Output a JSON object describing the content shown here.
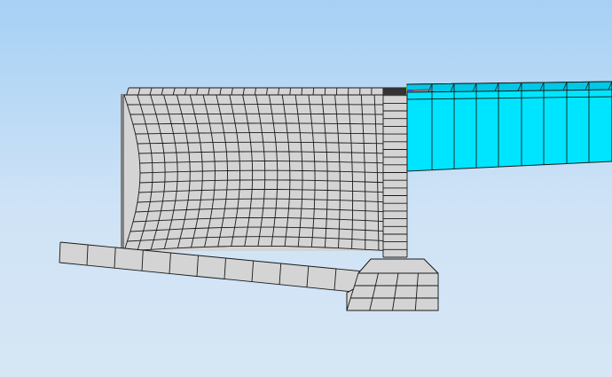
{
  "viewport": {
    "name": "fem-model-viewport",
    "background_top": "#a6d0f5",
    "background_bottom": "#d6e6f5"
  },
  "colors": {
    "mesh_fill": "#d4d4d4",
    "mesh_line": "#1a1a1a",
    "selected_fill": "#00e5ff",
    "selected_dark": "#00c8e6",
    "inner_wall_shadow": "#808080",
    "axis_x": "#e03030",
    "axis_y": "#30c030",
    "axis_z": "#3040e0"
  },
  "model": {
    "parts": [
      "backfill-block",
      "wall-stem",
      "footing-slab",
      "toe-block",
      "selected-member",
      "axis-triad"
    ],
    "selected_part": "selected-member"
  }
}
